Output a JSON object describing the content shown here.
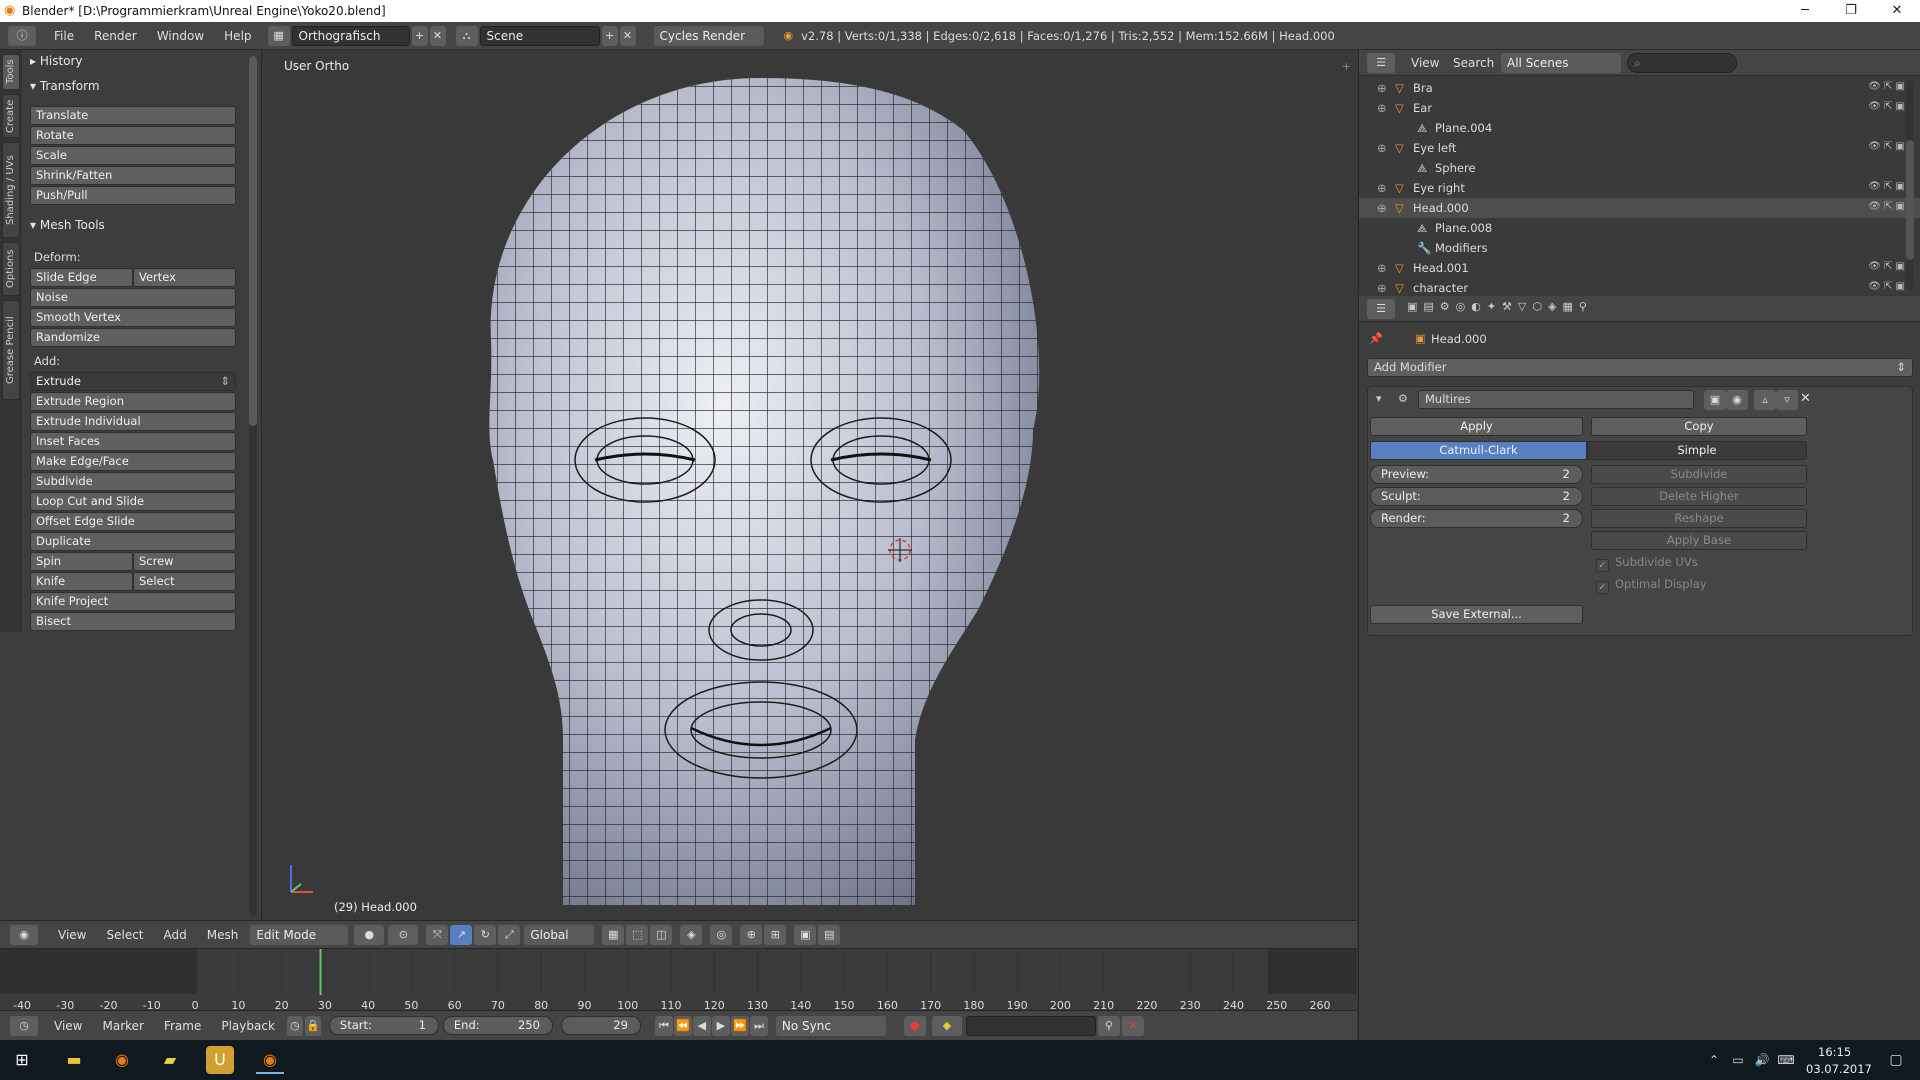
{
  "window": {
    "title": "Blender* [D:\\Programmierkram\\Unreal Engine\\Yoko20.blend]",
    "minimize": "─",
    "restore": "❐",
    "close": "✕"
  },
  "info_header": {
    "menus": [
      "File",
      "Render",
      "Window",
      "Help"
    ],
    "layout": "Orthografisch",
    "scene": "Scene",
    "engine": "Cycles Render",
    "stats": "v2.78 | Verts:0/1,338 | Edges:0/2,618 | Faces:0/1,276 | Tris:2,552 | Mem:152.66M | Head.000"
  },
  "toolshelf": {
    "tabs": [
      "Tools",
      "Create",
      "Shading / UVs",
      "Options",
      "Grease Pencil"
    ],
    "history": "History",
    "transform": {
      "title": "Transform",
      "buttons": [
        "Translate",
        "Rotate",
        "Scale",
        "Shrink/Fatten",
        "Push/Pull"
      ]
    },
    "mesh_tools": {
      "title": "Mesh Tools",
      "deform_label": "Deform:",
      "slide_edge": "Slide Edge",
      "vertex": "Vertex",
      "deform_buttons": [
        "Noise",
        "Smooth Vertex",
        "Randomize"
      ],
      "add_label": "Add:",
      "extrude": "Extrude",
      "add_buttons": [
        "Extrude Region",
        "Extrude Individual",
        "Inset Faces",
        "Make Edge/Face",
        "Subdivide",
        "Loop Cut and Slide",
        "Offset Edge Slide",
        "Duplicate"
      ],
      "spin": "Spin",
      "screw": "Screw",
      "knife": "Knife",
      "select": "Select",
      "more_buttons": [
        "Knife Project",
        "Bisect"
      ]
    }
  },
  "viewport": {
    "view_label": "User Ortho",
    "object_label": "(29) Head.000"
  },
  "outliner": {
    "view": "View",
    "search": "Search",
    "scenes": "All Scenes",
    "rows": [
      {
        "name": "Bra",
        "type": "object",
        "indent": 0
      },
      {
        "name": "Ear",
        "type": "object",
        "indent": 0
      },
      {
        "name": "Plane.004",
        "type": "mesh",
        "indent": 1
      },
      {
        "name": "Eye left",
        "type": "object",
        "indent": 0
      },
      {
        "name": "Sphere",
        "type": "mesh",
        "indent": 1
      },
      {
        "name": "Eye right",
        "type": "object",
        "indent": 0
      },
      {
        "name": "Head.000",
        "type": "object",
        "indent": 0,
        "selected": true
      },
      {
        "name": "Plane.008",
        "type": "mesh",
        "indent": 1
      },
      {
        "name": "Modifiers",
        "type": "modifier",
        "indent": 1
      },
      {
        "name": "Head.001",
        "type": "object",
        "indent": 0
      },
      {
        "name": "character",
        "type": "object",
        "indent": 0
      }
    ]
  },
  "properties": {
    "breadcrumb": "Head.000",
    "add_modifier": "Add Modifier",
    "modifier": {
      "name": "Multires",
      "apply": "Apply",
      "copy": "Copy",
      "catmull": "Catmull-Clark",
      "simple": "Simple",
      "preview_label": "Preview:",
      "preview_value": "2",
      "sculpt_label": "Sculpt:",
      "sculpt_value": "2",
      "render_label": "Render:",
      "render_value": "2",
      "subdivide": "Subdivide",
      "delete_higher": "Delete Higher",
      "reshape": "Reshape",
      "apply_base": "Apply Base",
      "subdivide_uvs": "Subdivide UVs",
      "optimal_display": "Optimal Display",
      "save_external": "Save External..."
    }
  },
  "viewport_header": {
    "view": "View",
    "select": "Select",
    "add": "Add",
    "mesh": "Mesh",
    "mode": "Edit Mode",
    "orientation": "Global"
  },
  "timeline": {
    "ticks": [
      "-40",
      "-30",
      "-20",
      "-10",
      "0",
      "10",
      "20",
      "30",
      "40",
      "50",
      "60",
      "70",
      "80",
      "90",
      "100",
      "110",
      "120",
      "130",
      "140",
      "150",
      "160",
      "170",
      "180",
      "190",
      "200",
      "210",
      "220",
      "230",
      "240",
      "250",
      "260"
    ],
    "current_frame": 29,
    "view": "View",
    "marker": "Marker",
    "frame": "Frame",
    "playback": "Playback",
    "start_label": "Start:",
    "start_value": "1",
    "end_label": "End:",
    "end_value": "250",
    "frame_value": "29",
    "sync": "No Sync"
  },
  "taskbar": {
    "time": "16:15",
    "date": "03.07.2017"
  }
}
